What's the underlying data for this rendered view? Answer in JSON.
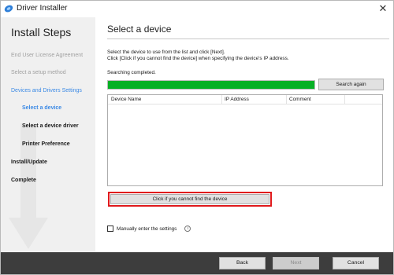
{
  "window": {
    "title": "Driver Installer",
    "close_glyph": "✕"
  },
  "sidebar": {
    "title": "Install Steps",
    "steps": [
      {
        "label": "End User License Agreement",
        "state": "done"
      },
      {
        "label": "Select a setup method",
        "state": "done"
      },
      {
        "label": "Devices and Drivers Settings",
        "state": "active"
      },
      {
        "label": "Select a device",
        "state": "active-sub"
      },
      {
        "label": "Select a device driver",
        "state": "pending-sub"
      },
      {
        "label": "Printer Preference",
        "state": "pending-sub"
      },
      {
        "label": "Install/Update",
        "state": "pending"
      },
      {
        "label": "Complete",
        "state": "pending"
      }
    ]
  },
  "main": {
    "title": "Select a device",
    "instructions": [
      "Select the device to use from the list and click [Next].",
      "Click [Click if you cannot find the device] when specifying the device's IP address."
    ],
    "status": "Searching completed.",
    "progress": 1.0,
    "search_again_label": "Search again",
    "table": {
      "columns": [
        "Device Name",
        "IP Address",
        "Comment"
      ],
      "rows": []
    },
    "cannot_find_label": "Click if you cannot find the device",
    "manual_label": "Manually enter the settings",
    "manual_checked": false,
    "info_glyph": "i"
  },
  "footer": {
    "back": "Back",
    "next": "Next",
    "cancel": "Cancel"
  },
  "colors": {
    "accent": "#3c8ae5",
    "progress": "#06b025",
    "highlight": "#e0191c",
    "footer": "#3d3d3d"
  },
  "icons": [
    "app-icon",
    "close-icon",
    "info-icon",
    "step-arrow-icon"
  ]
}
